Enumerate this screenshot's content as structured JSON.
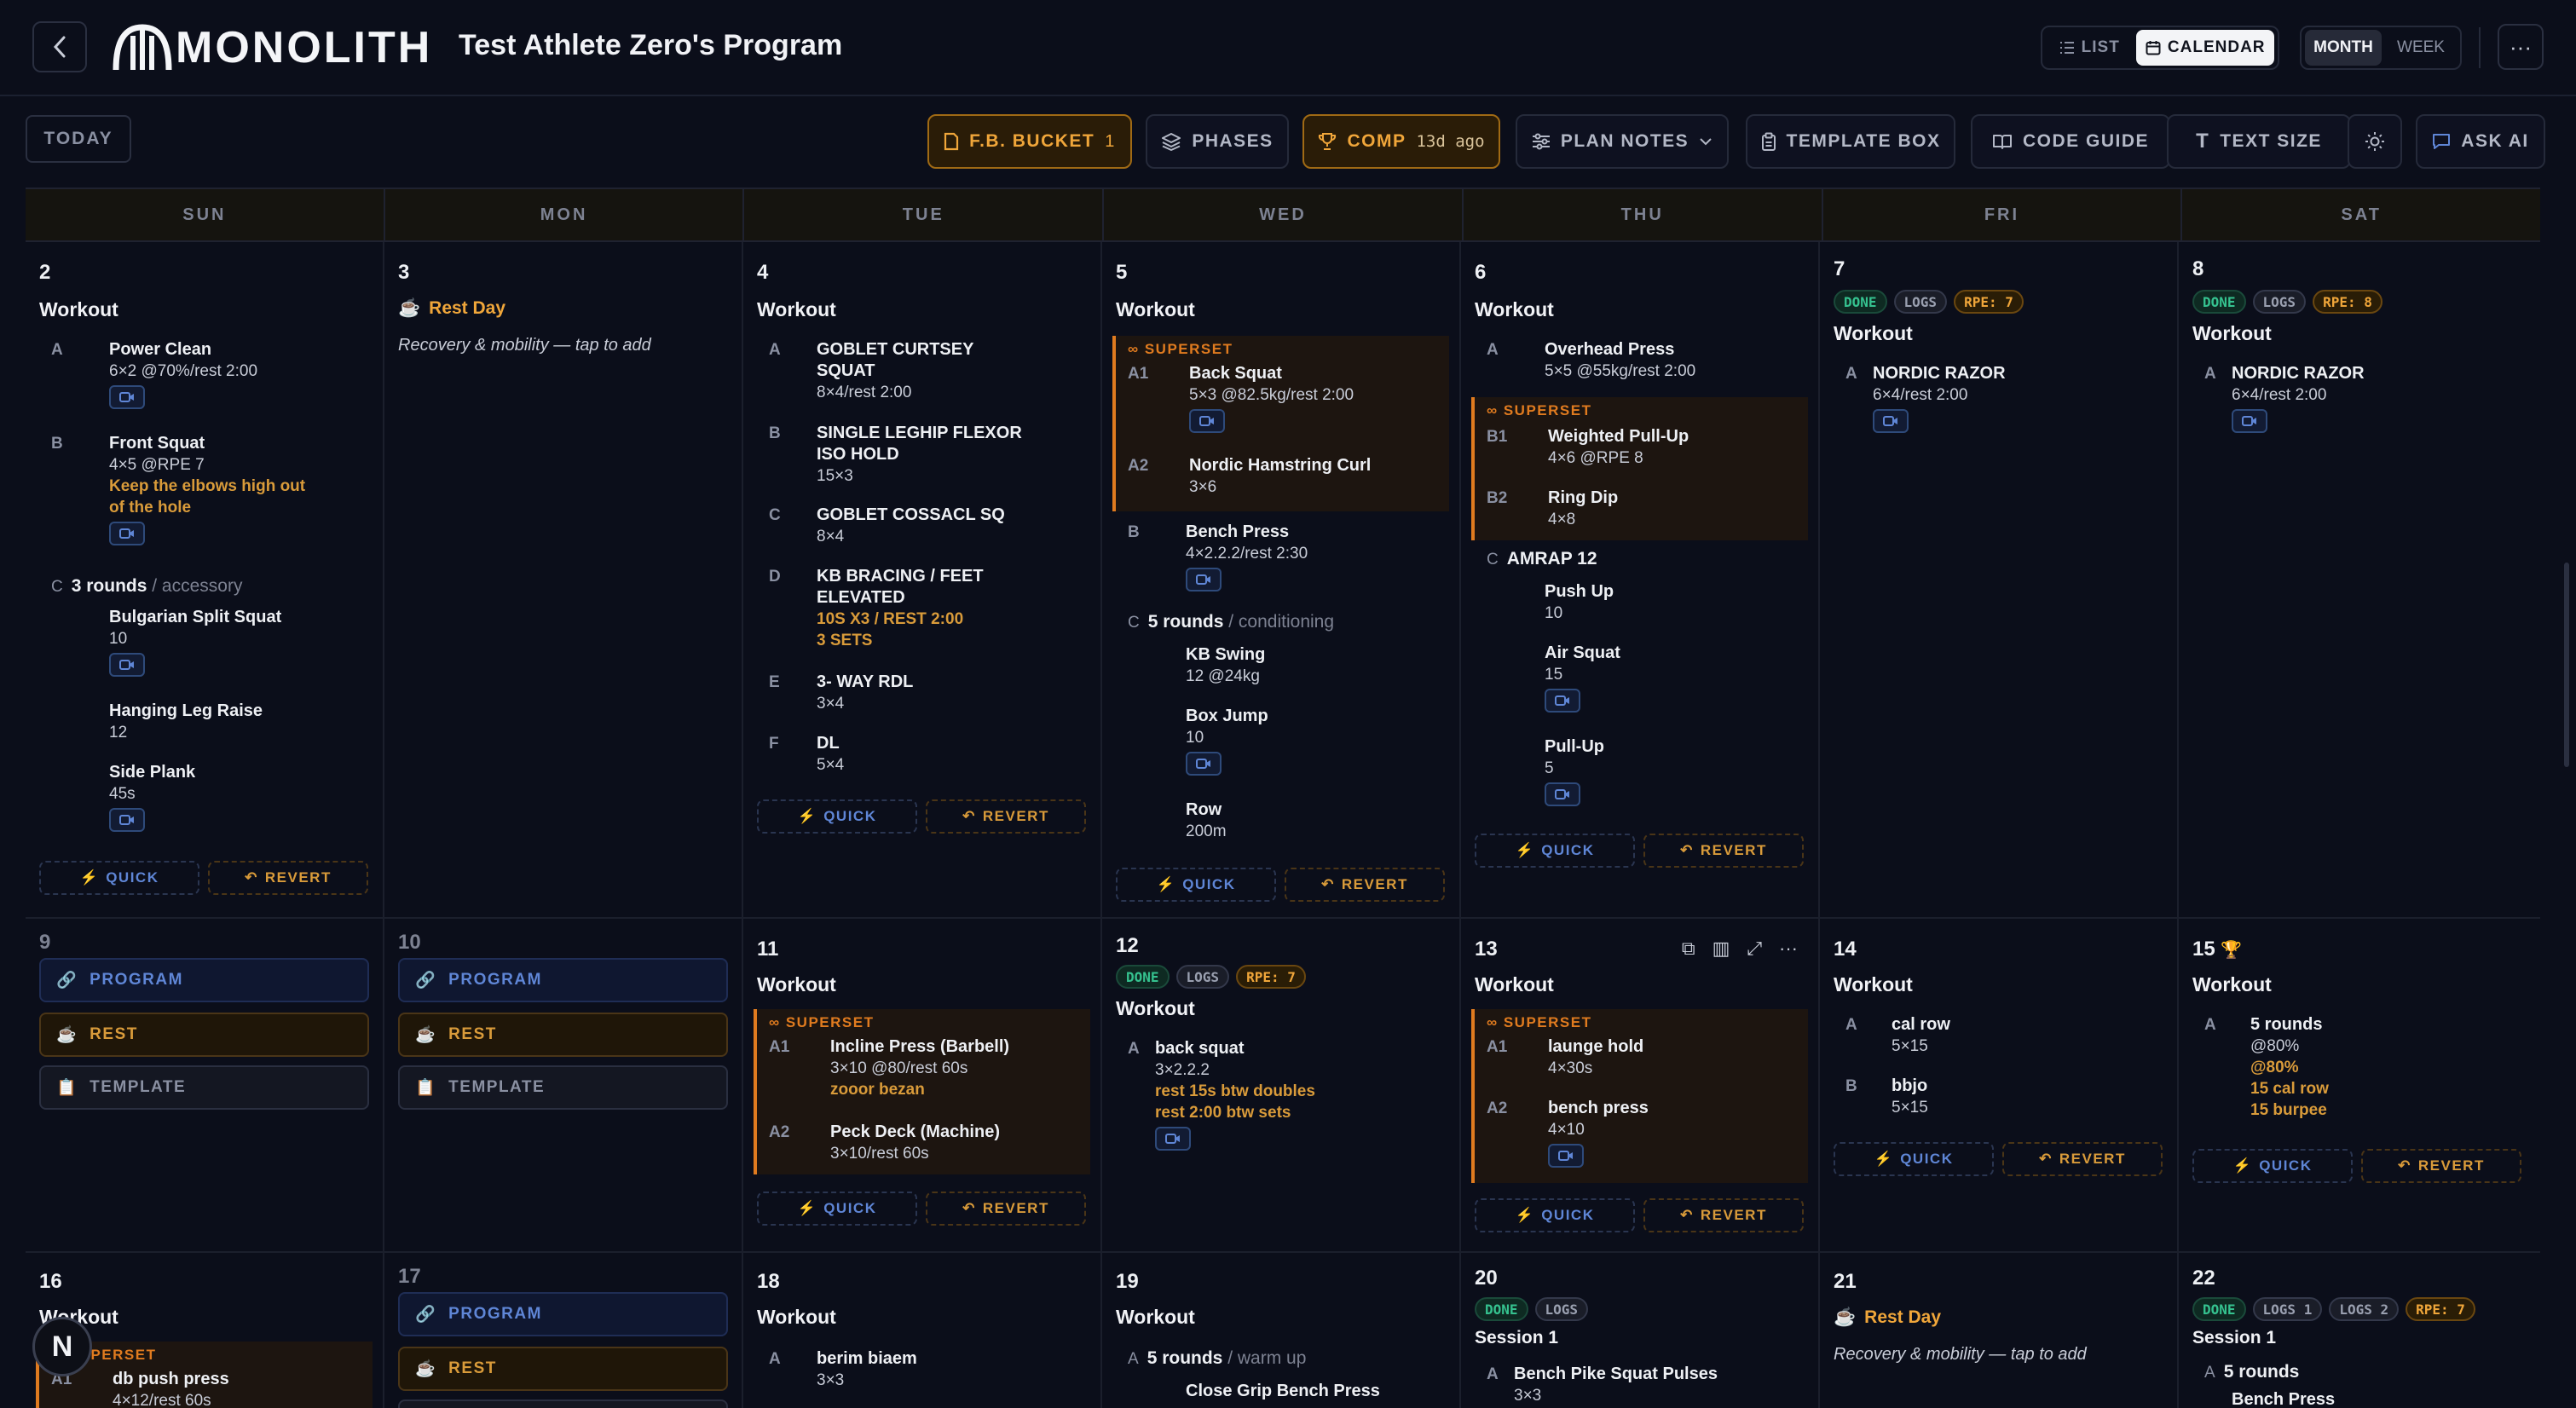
{
  "header": {
    "brand": "MONOLITH",
    "program_title": "Test Athlete Zero's Program",
    "view_modes": [
      "LIST",
      "CALENDAR"
    ],
    "ranges": [
      "MONTH",
      "WEEK"
    ]
  },
  "toolbar": {
    "today": "TODAY",
    "fb_bucket": "F.B. BUCKET",
    "fb_count": "1",
    "phases": "PHASES",
    "comp": "COMP",
    "comp_ago": "13d ago",
    "plan_notes": "PLAN NOTES",
    "template_box": "TEMPLATE BOX",
    "code_guide": "CODE GUIDE",
    "text_size": "TEXT SIZE",
    "ask_ai": "ASK AI"
  },
  "weekdays": [
    "SUN",
    "MON",
    "TUE",
    "WED",
    "THU",
    "FRI",
    "SAT"
  ],
  "common": {
    "workout": "Workout",
    "quick": "QUICK",
    "revert": "REVERT",
    "superset": "SUPERSET",
    "rest_day": "Rest Day",
    "rest_sub": "Recovery & mobility — tap to add",
    "program": "PROGRAM",
    "rest": "REST",
    "template": "TEMPLATE",
    "done": "DONE",
    "logs": "LOGS",
    "rpe7": "RPE: 7",
    "rpe8": "RPE: 8",
    "logs1": "LOGS 1",
    "logs2": "LOGS 2",
    "session1": "Session 1"
  },
  "days": {
    "d2": {
      "num": "2",
      "a": {
        "l": "A",
        "n": "Power Clean",
        "s": "6×2 @70%/rest 2:00"
      },
      "b": {
        "l": "B",
        "n": "Front Squat",
        "s": "4×5 @RPE 7",
        "note1": "Keep the elbows high out",
        "note2": "of the hole"
      },
      "c": {
        "l": "C",
        "rounds": "3 rounds",
        "tag": "/ accessory"
      },
      "c1": {
        "n": "Bulgarian Split Squat",
        "s": "10"
      },
      "c2": {
        "n": "Hanging Leg Raise",
        "s": "12"
      },
      "c3": {
        "n": "Side Plank",
        "s": "45s"
      }
    },
    "d3": {
      "num": "3"
    },
    "d4": {
      "num": "4",
      "a": {
        "l": "A",
        "n1": "GOBLET CURTSEY",
        "n2": "SQUAT",
        "s": "8×4/rest 2:00"
      },
      "b": {
        "l": "B",
        "n1": "SINGLE LEGHIP FLEXOR",
        "n2": "ISO HOLD",
        "s": "15×3"
      },
      "c": {
        "l": "C",
        "n": "GOBLET COSSACL SQ",
        "s": "8×4"
      },
      "d": {
        "l": "D",
        "n1": "KB BRACING / FEET",
        "n2": "ELEVATED",
        "note1": "10S X3 / REST 2:00",
        "note2": "3 SETS"
      },
      "e": {
        "l": "E",
        "n": "3- WAY RDL",
        "s": "3×4"
      },
      "f": {
        "l": "F",
        "n": "DL",
        "s": "5×4"
      }
    },
    "d5": {
      "num": "5",
      "a1": {
        "l": "A1",
        "n": "Back Squat",
        "s": "5×3 @82.5kg/rest 2:00"
      },
      "a2": {
        "l": "A2",
        "n": "Nordic Hamstring Curl",
        "s": "3×6"
      },
      "b": {
        "l": "B",
        "n": "Bench Press",
        "s": "4×2.2.2/rest 2:30"
      },
      "c": {
        "l": "C",
        "rounds": "5 rounds",
        "tag": "/ conditioning"
      },
      "c1": {
        "n": "KB Swing",
        "s": "12 @24kg"
      },
      "c2": {
        "n": "Box Jump",
        "s": "10"
      },
      "c3": {
        "n": "Row",
        "s": "200m"
      }
    },
    "d6": {
      "num": "6",
      "a": {
        "l": "A",
        "n": "Overhead Press",
        "s": "5×5 @55kg/rest 2:00"
      },
      "b1": {
        "l": "B1",
        "n": "Weighted Pull-Up",
        "s": "4×6 @RPE 8"
      },
      "b2": {
        "l": "B2",
        "n": "Ring Dip",
        "s": "4×8"
      },
      "c": {
        "l": "C",
        "n": "AMRAP 12"
      },
      "c1": {
        "n": "Push Up",
        "s": "10"
      },
      "c2": {
        "n": "Air Squat",
        "s": "15"
      },
      "c3": {
        "n": "Pull-Up",
        "s": "5"
      }
    },
    "d7": {
      "num": "7",
      "a": {
        "l": "A",
        "n": "NORDIC RAZOR",
        "s": "6×4/rest 2:00"
      }
    },
    "d8": {
      "num": "8",
      "a": {
        "l": "A",
        "n": "NORDIC RAZOR",
        "s": "6×4/rest 2:00"
      }
    },
    "d9": {
      "num": "9"
    },
    "d10": {
      "num": "10"
    },
    "d11": {
      "num": "11",
      "a1": {
        "l": "A1",
        "n": "Incline Press (Barbell)",
        "s": "3×10 @80/rest 60s",
        "note": "zooor bezan"
      },
      "a2": {
        "l": "A2",
        "n": "Peck Deck (Machine)",
        "s": "3×10/rest 60s"
      }
    },
    "d12": {
      "num": "12",
      "a": {
        "l": "A",
        "n": "back squat",
        "s": "3×2.2.2",
        "note1": "rest 15s btw doubles",
        "note2": "rest 2:00 btw sets"
      }
    },
    "d13": {
      "num": "13",
      "a1": {
        "l": "A1",
        "n": "launge hold",
        "s": "4×30s"
      },
      "a2": {
        "l": "A2",
        "n": "bench press",
        "s": "4×10"
      }
    },
    "d14": {
      "num": "14",
      "a": {
        "l": "A",
        "n": "cal row",
        "s": "5×15"
      },
      "b": {
        "l": "B",
        "n": "bbjo",
        "s": "5×15"
      }
    },
    "d15": {
      "num": "15",
      "a": {
        "l": "A",
        "n": "5 rounds",
        "s": "@80%",
        "note1": "@80%",
        "note2": "15 cal row",
        "note3": "15 burpee"
      }
    },
    "d16": {
      "num": "16",
      "a1": {
        "l": "A1",
        "n": "db push press",
        "s": "4×12/rest 60s"
      }
    },
    "d17": {
      "num": "17"
    },
    "d18": {
      "num": "18",
      "a": {
        "l": "A",
        "n": "berim biaem",
        "s": "3×3"
      }
    },
    "d19": {
      "num": "19",
      "a": {
        "l": "A",
        "rounds": "5 rounds",
        "tag": "/ warm up"
      },
      "a1": {
        "n": "Close Grip Bench Press"
      }
    },
    "d20": {
      "num": "20",
      "a": {
        "l": "A",
        "n": "Bench Pike Squat Pulses",
        "s": "3×3"
      }
    },
    "d21": {
      "num": "21"
    },
    "d22": {
      "num": "22",
      "a": {
        "l": "A",
        "rounds": "5 rounds"
      },
      "a1": {
        "n": "Bench Press"
      }
    }
  },
  "user": {
    "initial": "N"
  },
  "icons": {
    "back": "chevron-left-icon",
    "more": "more-horizontal-icon",
    "video": "video-icon",
    "trophy": "trophy-icon"
  }
}
